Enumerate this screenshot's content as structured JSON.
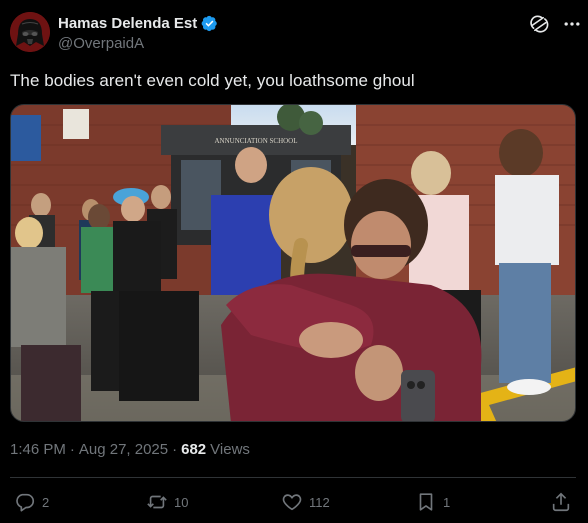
{
  "author": {
    "display_name": "Hamas Delenda Est",
    "handle": "@OverpaidA",
    "verified": true,
    "avatar_icon": "darth-vader-avatar"
  },
  "tweet": {
    "text": "The bodies aren't even cold yet, you loathsome ghoul"
  },
  "media": {
    "sign_text": "ANNUNCIATION SCHOOL"
  },
  "meta": {
    "time": "1:46 PM",
    "separator": "·",
    "date": "Aug 27, 2025",
    "separator2": "·",
    "views_count": "682",
    "views_label": "Views"
  },
  "actions": {
    "replies": "2",
    "reposts": "10",
    "likes": "112",
    "bookmarks": "1"
  },
  "colors": {
    "background": "#000000",
    "text_primary": "#e7e9ea",
    "text_secondary": "#71767b",
    "verified_blue": "#1d9bf0",
    "divider": "#2f3336"
  }
}
